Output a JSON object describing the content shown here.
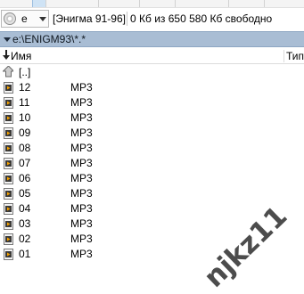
{
  "drive_bar": {
    "drive_letter": "e",
    "volume_label": "[Энигма 91-96]",
    "free_space": "0 Кб из 650 580 Кб свободно"
  },
  "path_bar": {
    "path": "e:\\ENIGM93\\*.*"
  },
  "columns": {
    "name": "Имя",
    "type": "Тип"
  },
  "parent_dir": {
    "label": "[..]"
  },
  "files": [
    {
      "name": "12",
      "ext": "MP3"
    },
    {
      "name": "11",
      "ext": "MP3"
    },
    {
      "name": "10",
      "ext": "MP3"
    },
    {
      "name": "09",
      "ext": "MP3"
    },
    {
      "name": "08",
      "ext": "MP3"
    },
    {
      "name": "07",
      "ext": "MP3"
    },
    {
      "name": "06",
      "ext": "MP3"
    },
    {
      "name": "05",
      "ext": "MP3"
    },
    {
      "name": "04",
      "ext": "MP3"
    },
    {
      "name": "03",
      "ext": "MP3"
    },
    {
      "name": "02",
      "ext": "MP3"
    },
    {
      "name": "01",
      "ext": "MP3"
    }
  ],
  "watermark": "njkz11"
}
